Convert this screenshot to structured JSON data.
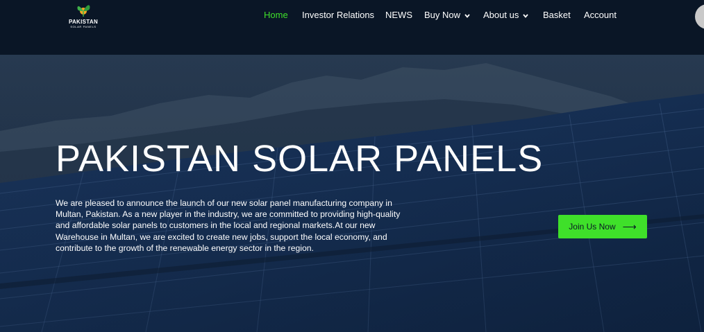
{
  "brand": {
    "title": "PAKISTAN",
    "subtitle": "SOLAR PANELS"
  },
  "nav": {
    "items": [
      {
        "label": "Home",
        "active": true,
        "dropdown": false
      },
      {
        "label": "Investor Relations",
        "active": false,
        "dropdown": false
      },
      {
        "label": "NEWS",
        "active": false,
        "dropdown": false
      },
      {
        "label": "Buy Now",
        "active": false,
        "dropdown": true
      },
      {
        "label": "About us",
        "active": false,
        "dropdown": true
      },
      {
        "label": "Basket",
        "active": false,
        "dropdown": false
      },
      {
        "label": "Account",
        "active": false,
        "dropdown": false
      }
    ]
  },
  "hero": {
    "title": "PAKISTAN SOLAR PANELS",
    "description": "We are pleased to announce the launch of our new solar panel manufacturing company in Multan, Pakistan. As a new player in the industry, we are committed to providing high-quality and affordable solar panels to customers in the local and regional markets.At our new Warehouse in Multan, we are excited to create new jobs, support the local economy, and contribute to the growth of the renewable energy sector in the region.",
    "cta_label": "Join Us Now",
    "cta_icon": "arrow-right-icon"
  },
  "colors": {
    "nav_bg": "#0a1626",
    "accent": "#3fe02a",
    "text": "#ffffff",
    "hero_overlay": "#0c1a2e"
  }
}
